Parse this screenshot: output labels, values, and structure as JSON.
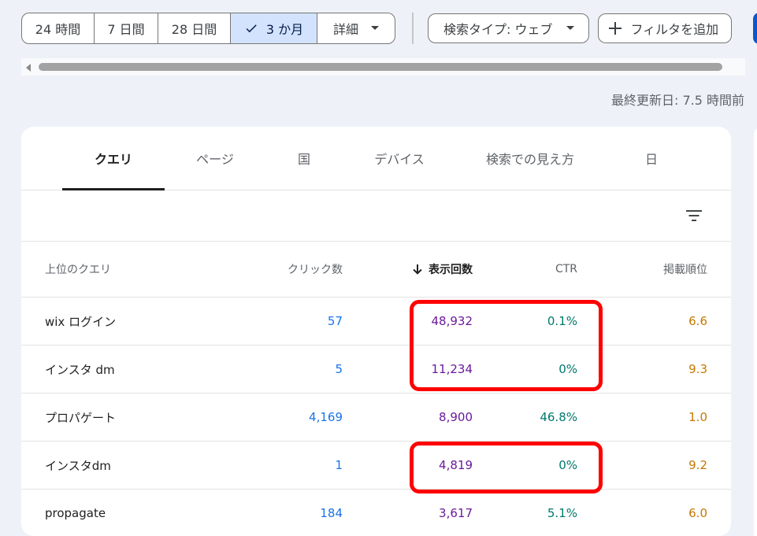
{
  "date_ranges": [
    {
      "label": "24 時間",
      "selected": false
    },
    {
      "label": "7 日間",
      "selected": false
    },
    {
      "label": "28 日間",
      "selected": false
    },
    {
      "label": "3 か月",
      "selected": true
    },
    {
      "label": "詳細",
      "selected": false
    }
  ],
  "search_type_label": "検索タイプ: ウェブ",
  "add_filter_label": "フィルタを追加",
  "last_updated": "最終更新日: 7.5 時間前",
  "tabs": [
    "クエリ",
    "ページ",
    "国",
    "デバイス",
    "検索での見え方",
    "日"
  ],
  "active_tab": "クエリ",
  "columns": {
    "query": "上位のクエリ",
    "clicks": "クリック数",
    "impressions": "表示回数",
    "ctr": "CTR",
    "position": "掲載順位"
  },
  "sort_column": "impressions",
  "rows": [
    {
      "query": "wix ログイン",
      "clicks": "57",
      "impressions": "48,932",
      "ctr": "0.1%",
      "position": "6.6",
      "highlighted": true
    },
    {
      "query": "インスタ dm",
      "clicks": "5",
      "impressions": "11,234",
      "ctr": "0%",
      "position": "9.3",
      "highlighted": true
    },
    {
      "query": "プロパゲート",
      "clicks": "4,169",
      "impressions": "8,900",
      "ctr": "46.8%",
      "position": "1.0",
      "highlighted": false
    },
    {
      "query": "インスタdm",
      "clicks": "1",
      "impressions": "4,819",
      "ctr": "0%",
      "position": "9.2",
      "highlighted": true
    },
    {
      "query": "propagate",
      "clicks": "184",
      "impressions": "3,617",
      "ctr": "5.1%",
      "position": "6.0",
      "highlighted": false
    }
  ],
  "colors": {
    "clicks": "#1a73e8",
    "impressions": "#6a1b9a",
    "ctr": "#00796b",
    "position": "#c77700",
    "highlight": "#ff0000",
    "selected_range_bg": "#d3e3fd"
  }
}
